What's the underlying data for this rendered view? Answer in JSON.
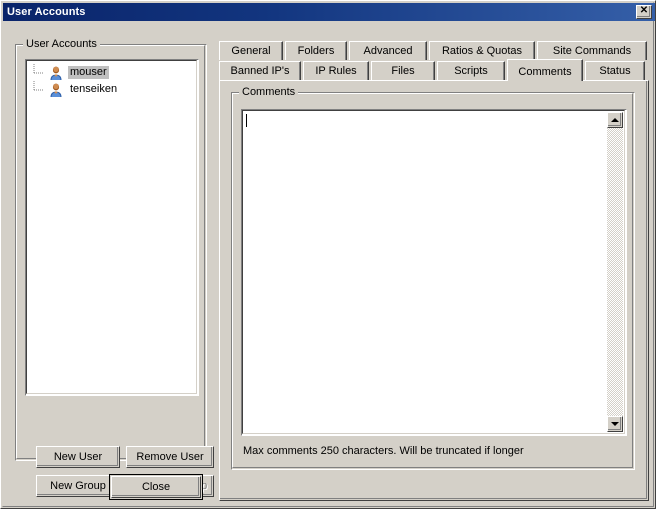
{
  "window": {
    "title": "User Accounts",
    "close_glyph": "✕"
  },
  "left_panel": {
    "group_label": "User Accounts",
    "users": [
      {
        "name": "mouser",
        "selected": true,
        "icon": "user-icon"
      },
      {
        "name": "tenseiken",
        "selected": false,
        "icon": "user-icon"
      }
    ],
    "buttons": [
      {
        "label": "New User",
        "enabled": true
      },
      {
        "label": "Remove User",
        "enabled": true
      },
      {
        "label": "New Group",
        "enabled": true
      },
      {
        "label": "Remove Group",
        "enabled": false
      }
    ],
    "close_button": "Close"
  },
  "tabs": {
    "row1": [
      {
        "label": "General",
        "active": false
      },
      {
        "label": "Folders",
        "active": false
      },
      {
        "label": "Advanced",
        "active": false
      },
      {
        "label": "Ratios & Quotas",
        "active": false
      },
      {
        "label": "Site Commands",
        "active": false
      }
    ],
    "row2": [
      {
        "label": "Banned IP's",
        "active": false
      },
      {
        "label": "IP Rules",
        "active": false
      },
      {
        "label": "Files",
        "active": false
      },
      {
        "label": "Scripts",
        "active": false
      },
      {
        "label": "Comments",
        "active": true
      },
      {
        "label": "Status",
        "active": false
      }
    ]
  },
  "comments_tab": {
    "group_label": "Comments",
    "textarea_value": "",
    "hint": "Max comments 250 characters. Will be truncated if longer",
    "scroll_up_icon": "arrow-up-icon",
    "scroll_down_icon": "arrow-down-icon"
  },
  "colors": {
    "face": "#d4d0c8",
    "titlebar_start": "#0a246a",
    "titlebar_end": "#355fa8",
    "selection": "#c0c0c0",
    "window_bg": "#ffffff"
  }
}
